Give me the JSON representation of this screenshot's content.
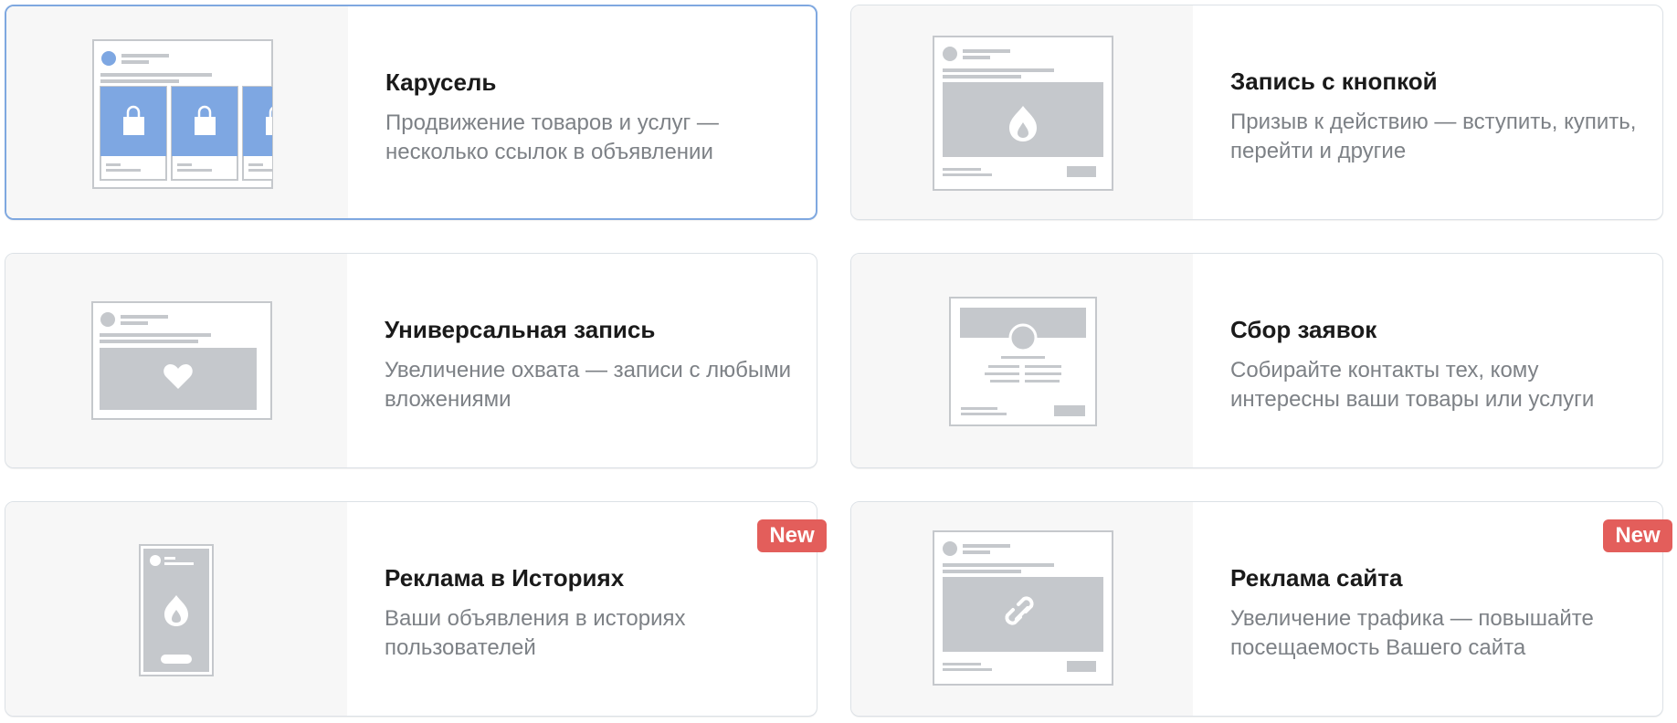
{
  "accent_color": "#7fa8e0",
  "badge_color": "#e35e5b",
  "cards": [
    {
      "title": "Карусель",
      "description": "Продвижение товаров и услуг — несколько ссылок в объявлении",
      "preview": "carousel-preview",
      "selected": true
    },
    {
      "title": "Запись с кнопкой",
      "description": "Призыв к действию — вступить, купить, перейти и другие",
      "preview": "button-post-preview",
      "icon": "fire-icon"
    },
    {
      "title": "Универсальная запись",
      "description": "Увеличение охвата — записи с любыми вложениями",
      "preview": "universal-post-preview",
      "icon": "heart-icon"
    },
    {
      "title": "Сбор заявок",
      "description": "Собирайте контакты тех, кому интересны ваши товары или услуги",
      "preview": "lead-form-preview"
    },
    {
      "title": "Реклама в Историях",
      "description": "Ваши объявления в историях пользователей",
      "preview": "story-preview",
      "icon": "fire-icon",
      "badge": "New"
    },
    {
      "title": "Реклама сайта",
      "description": "Увеличение трафика — повышайте посещаемость Вашего сайта",
      "preview": "site-ad-preview",
      "icon": "link-icon",
      "badge": "New"
    }
  ]
}
